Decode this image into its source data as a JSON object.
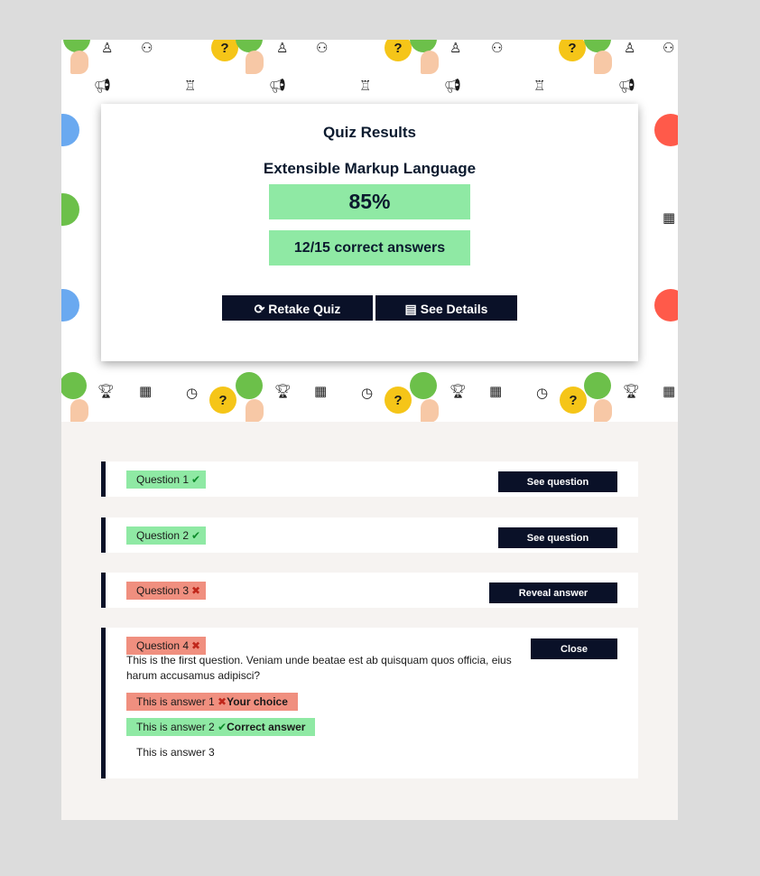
{
  "results": {
    "title": "Quiz Results",
    "topic": "Extensible Markup Language",
    "score": "85%",
    "correct_summary": "12/15 correct answers",
    "retake_label": "Retake Quiz",
    "details_label": "See Details"
  },
  "questions": [
    {
      "label": "Question 1",
      "status": "correct",
      "action": "See question"
    },
    {
      "label": "Question 2",
      "status": "correct",
      "action": "See question"
    },
    {
      "label": "Question 3",
      "status": "incorrect",
      "action": "Reveal answer"
    },
    {
      "label": "Question 4",
      "status": "incorrect",
      "action": "Close",
      "text": "This is the first question. Veniam unde beatae est ab quisquam quos officia, eius harum accusamus adipisci?",
      "answers": [
        {
          "text": "This is answer 1",
          "note": "Your choice",
          "state": "chosen"
        },
        {
          "text": "This is answer 2",
          "note": "Correct answer",
          "state": "correct"
        },
        {
          "text": "This is answer 3",
          "note": "",
          "state": "neutral"
        }
      ]
    }
  ],
  "icons": {
    "check": "check-icon",
    "cross": "cross-icon",
    "retake": "refresh-icon",
    "details": "clipboard-icon"
  },
  "colors": {
    "dark": "#0a1128",
    "success": "#8fe9a4",
    "error": "#f08f7f",
    "bubble_yellow": "#f5c518",
    "bubble_green": "#6cc04a"
  }
}
